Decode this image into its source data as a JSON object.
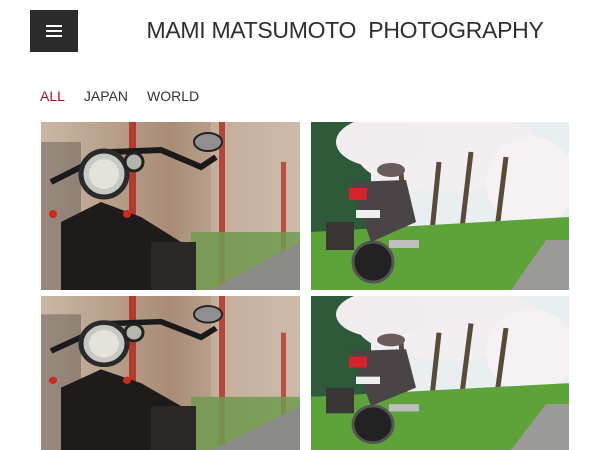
{
  "header": {
    "menu_icon": "hamburger-menu-icon",
    "title": "MAMI MATSUMOTO  PHOTOGRAPHY"
  },
  "filters": [
    {
      "label": "ALL",
      "active": true
    },
    {
      "label": "JAPAN",
      "active": false
    },
    {
      "label": "WORLD",
      "active": false
    }
  ],
  "colors": {
    "menu_bg": "#2b2b2b",
    "active_filter": "#8b1a1a",
    "text": "#333333"
  },
  "gallery": {
    "photos": [
      {
        "subject": "motorcycle-closeup"
      },
      {
        "subject": "motorcycle-cherry-blossoms"
      },
      {
        "subject": "motorcycle-closeup"
      },
      {
        "subject": "motorcycle-cherry-blossoms"
      }
    ]
  }
}
